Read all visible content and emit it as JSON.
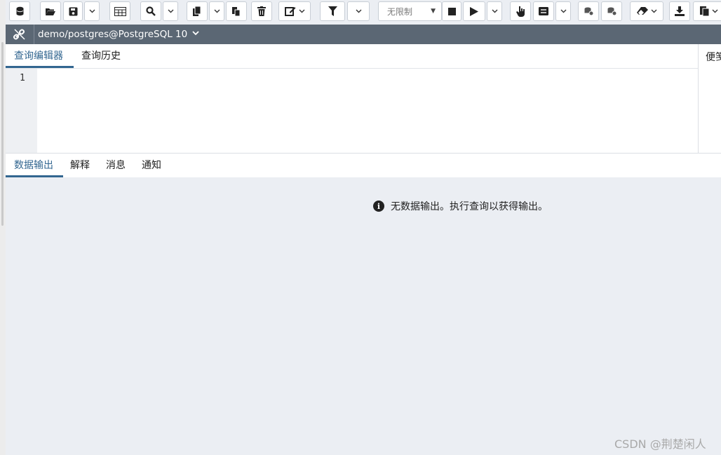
{
  "toolbar": {
    "buttons": [
      "database-icon",
      "folder-open-icon",
      "save-icon",
      "chevron-down-icon",
      "table-icon",
      "search-icon",
      "chevron-down-icon",
      "copy-icon",
      "chevron-down-icon",
      "paste-icon",
      "delete-icon",
      "edit-icon",
      "filter-icon",
      "chevron-down-icon",
      "stop-icon",
      "play-icon",
      "chevron-down-icon",
      "hand-icon",
      "list-icon",
      "chevron-down-icon",
      "commit-icon",
      "rollback-icon",
      "eraser-icon",
      "download-icon",
      "macro-icon"
    ],
    "limit_label": "无限制"
  },
  "connection": {
    "label": "demo/postgres@PostgreSQL 10",
    "icon": "link-icon"
  },
  "editor_tabs": [
    "查询编辑器",
    "查询历史"
  ],
  "side_panel_label": "便笺",
  "editor": {
    "line_numbers": [
      "1"
    ]
  },
  "output_tabs": [
    "数据输出",
    "解释",
    "消息",
    "通知"
  ],
  "output": {
    "empty_message": "无数据输出。执行查询以获得输出。"
  },
  "watermark": "CSDN @荆楚闲人"
}
